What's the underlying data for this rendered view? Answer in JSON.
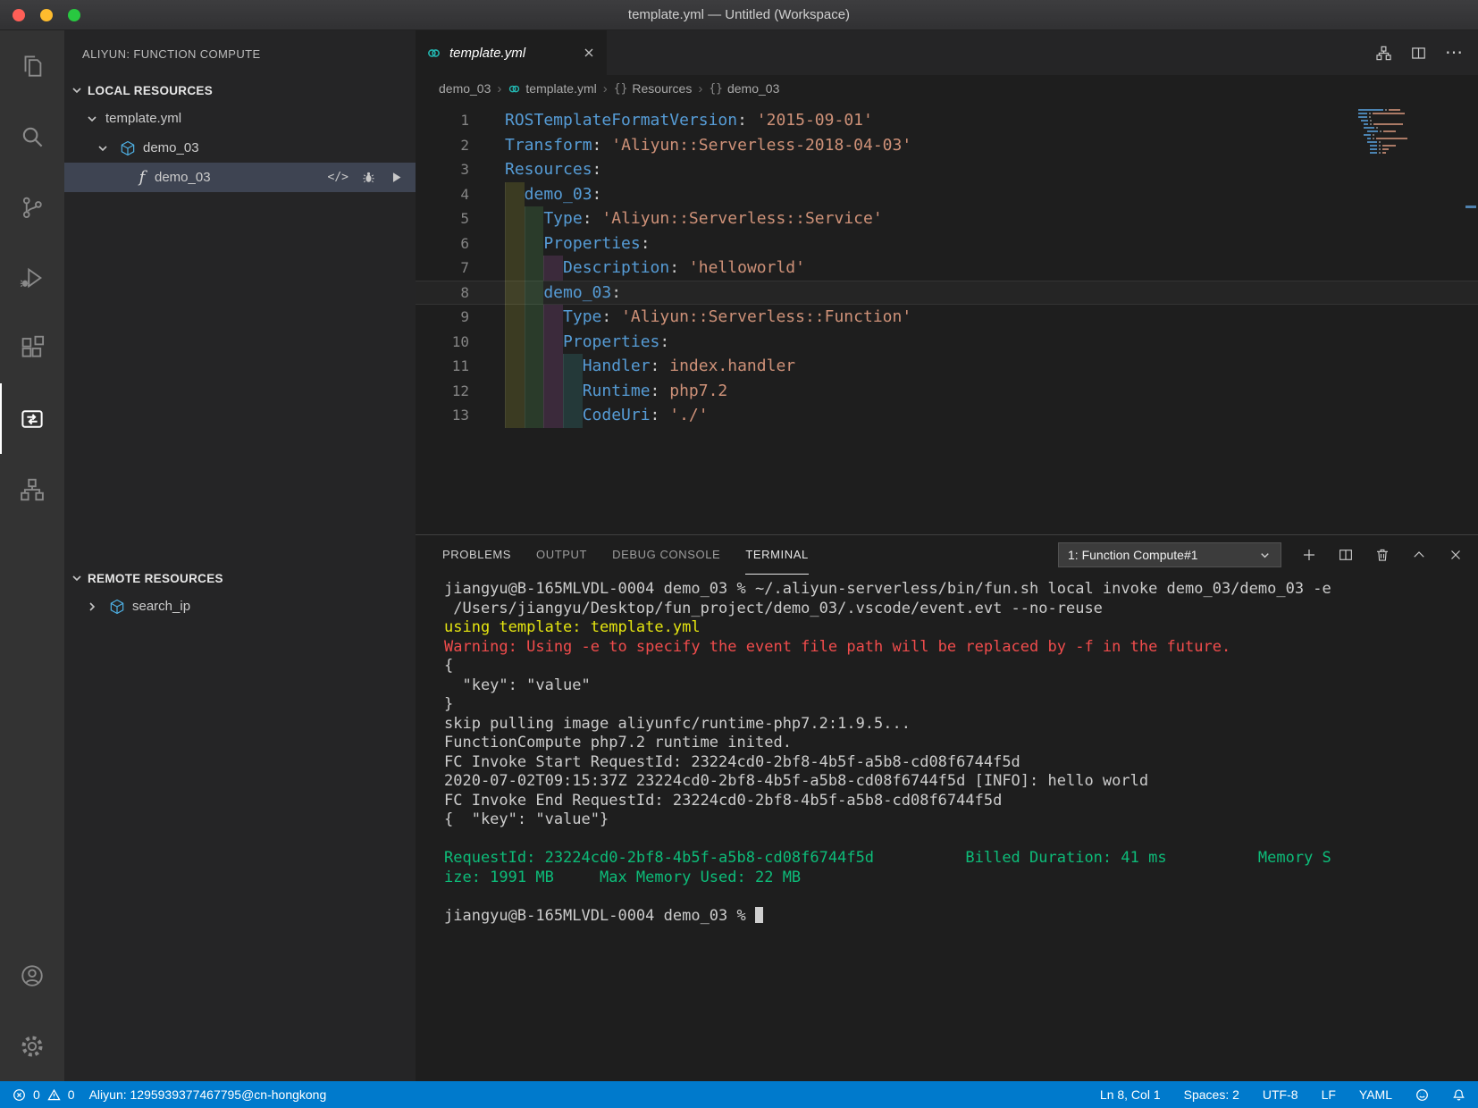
{
  "window": {
    "title": "template.yml — Untitled (Workspace)"
  },
  "activity_bar": {
    "items": [
      {
        "name": "explorer"
      },
      {
        "name": "search"
      },
      {
        "name": "source-control"
      },
      {
        "name": "run-and-debug"
      },
      {
        "name": "extensions"
      },
      {
        "name": "aliyun-function-compute",
        "active": true
      },
      {
        "name": "aliyun-deploy"
      }
    ],
    "bottom_items": [
      {
        "name": "accounts"
      },
      {
        "name": "settings"
      }
    ]
  },
  "sidebar": {
    "title": "ALIYUN: FUNCTION COMPUTE",
    "local": {
      "header": "LOCAL RESOURCES",
      "template_file": "template.yml",
      "service": "demo_03",
      "function": "demo_03"
    },
    "remote": {
      "header": "REMOTE RESOURCES",
      "item": "search_ip"
    }
  },
  "symbols": {
    "object_icon": "{}",
    "code_action": "</>",
    "more_actions": "⋯",
    "breadcrumb_separator": "›",
    "function_icon": "f"
  },
  "editor": {
    "tab": {
      "label": "template.yml"
    },
    "breadcrumb": [
      "demo_03",
      "template.yml",
      "Resources",
      "demo_03"
    ],
    "code_lines": [
      {
        "n": 1,
        "indent": 0,
        "tokens": [
          [
            "key",
            "ROSTemplateFormatVersion"
          ],
          [
            "punc",
            ": "
          ],
          [
            "str",
            "'2015-09-01'"
          ]
        ]
      },
      {
        "n": 2,
        "indent": 0,
        "tokens": [
          [
            "key",
            "Transform"
          ],
          [
            "punc",
            ": "
          ],
          [
            "str",
            "'Aliyun::Serverless-2018-04-03'"
          ]
        ]
      },
      {
        "n": 3,
        "indent": 0,
        "tokens": [
          [
            "key",
            "Resources"
          ],
          [
            "punc",
            ":"
          ]
        ]
      },
      {
        "n": 4,
        "indent": 2,
        "tokens": [
          [
            "key",
            "demo_03"
          ],
          [
            "punc",
            ":"
          ]
        ]
      },
      {
        "n": 5,
        "indent": 4,
        "tokens": [
          [
            "key",
            "Type"
          ],
          [
            "punc",
            ": "
          ],
          [
            "str",
            "'Aliyun::Serverless::Service'"
          ]
        ]
      },
      {
        "n": 6,
        "indent": 4,
        "tokens": [
          [
            "key",
            "Properties"
          ],
          [
            "punc",
            ":"
          ]
        ]
      },
      {
        "n": 7,
        "indent": 6,
        "tokens": [
          [
            "key",
            "Description"
          ],
          [
            "punc",
            ": "
          ],
          [
            "str",
            "'helloworld'"
          ]
        ]
      },
      {
        "n": 8,
        "indent": 4,
        "current": true,
        "tokens": [
          [
            "key",
            "demo_03"
          ],
          [
            "punc",
            ":"
          ]
        ]
      },
      {
        "n": 9,
        "indent": 6,
        "tokens": [
          [
            "key",
            "Type"
          ],
          [
            "punc",
            ": "
          ],
          [
            "str",
            "'Aliyun::Serverless::Function'"
          ]
        ]
      },
      {
        "n": 10,
        "indent": 6,
        "tokens": [
          [
            "key",
            "Properties"
          ],
          [
            "punc",
            ":"
          ]
        ]
      },
      {
        "n": 11,
        "indent": 8,
        "tokens": [
          [
            "key",
            "Handler"
          ],
          [
            "punc",
            ": "
          ],
          [
            "str",
            "index.handler"
          ]
        ]
      },
      {
        "n": 12,
        "indent": 8,
        "tokens": [
          [
            "key",
            "Runtime"
          ],
          [
            "punc",
            ": "
          ],
          [
            "str",
            "php7.2"
          ]
        ]
      },
      {
        "n": 13,
        "indent": 8,
        "tokens": [
          [
            "key",
            "CodeUri"
          ],
          [
            "punc",
            ": "
          ],
          [
            "str",
            "'./'"
          ]
        ]
      }
    ]
  },
  "panel": {
    "tabs": [
      {
        "label": "PROBLEMS",
        "active": false
      },
      {
        "label": "OUTPUT",
        "active": false
      },
      {
        "label": "DEBUG CONSOLE",
        "active": false
      },
      {
        "label": "TERMINAL",
        "active": true
      }
    ],
    "terminal_selector": "1: Function Compute#1",
    "terminal_lines": [
      {
        "color": "default",
        "text": "jiangyu@B-165MLVDL-0004 demo_03 % ~/.aliyun-serverless/bin/fun.sh local invoke demo_03/demo_03 -e"
      },
      {
        "color": "default",
        "text": " /Users/jiangyu/Desktop/fun_project/demo_03/.vscode/event.evt --no-reuse"
      },
      {
        "color": "yellow",
        "text": "using template: template.yml"
      },
      {
        "color": "red",
        "text": "Warning: Using -e to specify the event file path will be replaced by -f in the future."
      },
      {
        "color": "default",
        "text": "{"
      },
      {
        "color": "default",
        "text": "  \"key\": \"value\""
      },
      {
        "color": "default",
        "text": "}"
      },
      {
        "color": "default",
        "text": "skip pulling image aliyunfc/runtime-php7.2:1.9.5..."
      },
      {
        "color": "default",
        "text": "FunctionCompute php7.2 runtime inited."
      },
      {
        "color": "default",
        "text": "FC Invoke Start RequestId: 23224cd0-2bf8-4b5f-a5b8-cd08f6744f5d"
      },
      {
        "color": "default",
        "text": "2020-07-02T09:15:37Z 23224cd0-2bf8-4b5f-a5b8-cd08f6744f5d [INFO]: hello world"
      },
      {
        "color": "default",
        "text": "FC Invoke End RequestId: 23224cd0-2bf8-4b5f-a5b8-cd08f6744f5d"
      },
      {
        "color": "default",
        "text": "{  \"key\": \"value\"}"
      },
      {
        "color": "default",
        "text": ""
      },
      {
        "color": "green",
        "text": "RequestId: 23224cd0-2bf8-4b5f-a5b8-cd08f6744f5d          Billed Duration: 41 ms          Memory S"
      },
      {
        "color": "green",
        "text": "ize: 1991 MB     Max Memory Used: 22 MB"
      },
      {
        "color": "default",
        "text": ""
      },
      {
        "color": "default",
        "text": "jiangyu@B-165MLVDL-0004 demo_03 % ",
        "cursor": true
      }
    ]
  },
  "status_bar": {
    "errors": "0",
    "warnings": "0",
    "account": "Aliyun: 1295939377467795@cn-hongkong",
    "cursor": "Ln 8, Col 1",
    "indentation": "Spaces: 2",
    "encoding": "UTF-8",
    "eol": "LF",
    "language": "YAML"
  },
  "colors": {
    "status_bar_bg": "#007acc",
    "aliyun_teal": "#23b6b0",
    "terminal_green": "#0dbc79",
    "terminal_red": "#f14c4c",
    "terminal_yellow": "#e5e510"
  }
}
